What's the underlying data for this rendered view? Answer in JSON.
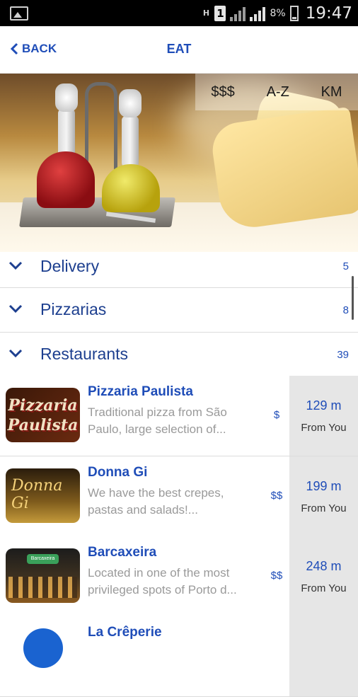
{
  "status_bar": {
    "network_type": "H",
    "sim": "1",
    "battery": "8%",
    "time": "19:47"
  },
  "header": {
    "back_label": "BACK",
    "title": "EAT"
  },
  "sort": {
    "options": [
      "$$$",
      "A-Z",
      "KM"
    ]
  },
  "categories": [
    {
      "label": "Delivery",
      "count": "5"
    },
    {
      "label": "Pizzarias",
      "count": "8"
    },
    {
      "label": "Restaurants",
      "count": "39"
    }
  ],
  "items": [
    {
      "name": "Pizzaria Paulista",
      "description": "Traditional pizza from São Paulo, large selection of...",
      "price": "$",
      "distance": "129 m",
      "from_label": "From You",
      "logo_text_1": "Pizzaria",
      "logo_text_2": "Paulista"
    },
    {
      "name": "Donna Gi",
      "description": "We have the best crepes, pastas and salads!...",
      "price": "$$",
      "distance": "199 m",
      "from_label": "From You",
      "logo_text_1": "Donna Gi"
    },
    {
      "name": "Barcaxeira",
      "description": "Located in one of the most privileged spots of Porto d...",
      "price": "$$",
      "distance": "248 m",
      "from_label": "From You",
      "logo_text_1": "Barcaxeira"
    },
    {
      "name": "La Crêperie",
      "description": "",
      "price": "",
      "distance": "",
      "from_label": ""
    }
  ],
  "colors": {
    "accent": "#1f4db8",
    "category_text": "#1d3f8f",
    "distance_panel": "#e6e6e6"
  }
}
